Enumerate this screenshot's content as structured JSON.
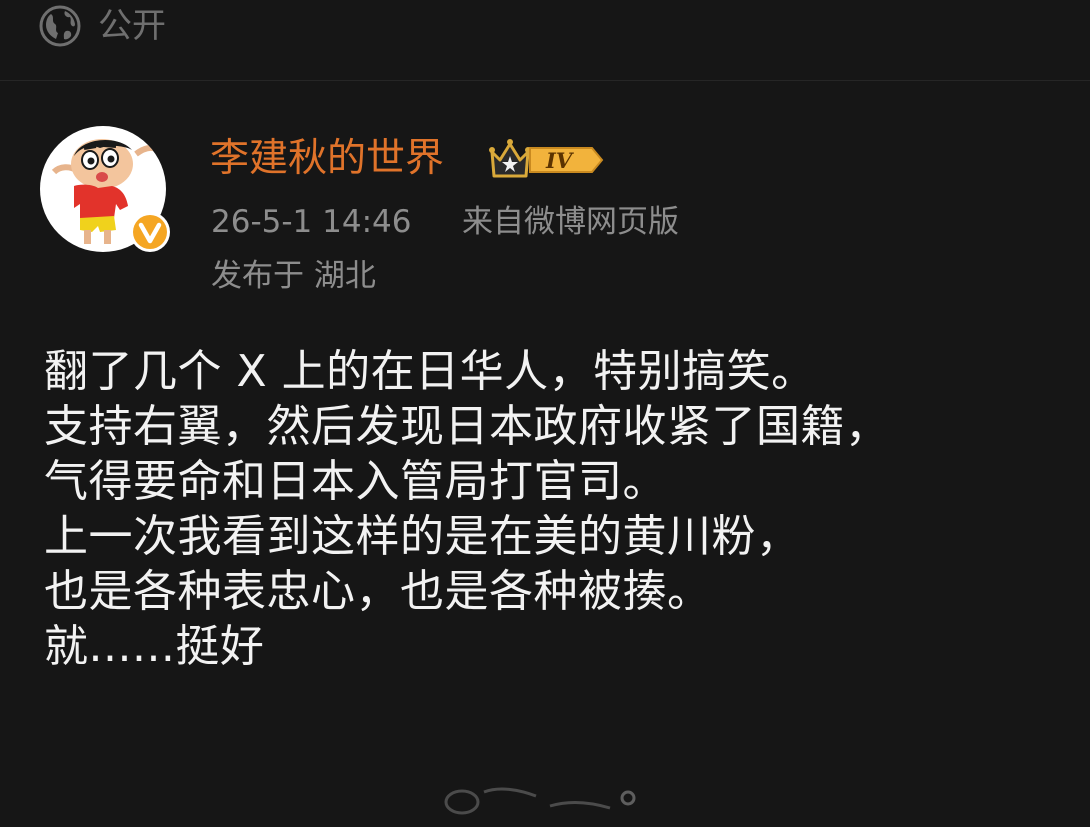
{
  "header": {
    "visibility_icon": "globe-icon",
    "visibility_label": "公开"
  },
  "author": {
    "name": "李建秋的世界",
    "level_badge": "IV",
    "verified_badge": "V",
    "avatar_icon": "cartoon-avatar-icon"
  },
  "meta": {
    "timestamp": "26-5-1 14:46",
    "source": "来自微博网页版",
    "location": "发布于 湖北"
  },
  "post": {
    "lines": [
      "翻了几个 X 上的在日华人，特别搞笑。",
      "支持右翼，然后发现日本政府收紧了国籍，",
      "气得要命和日本入管局打官司。",
      "上一次我看到这样的是在美的黄川粉，",
      "也是各种表忠心，也是各种被揍。",
      "就......挺好"
    ]
  },
  "colors": {
    "background": "#161616",
    "username": "#e0732a",
    "meta_text": "#8d8d8d",
    "body_text": "#f2f2f2",
    "verified_badge": "#f5a623"
  }
}
